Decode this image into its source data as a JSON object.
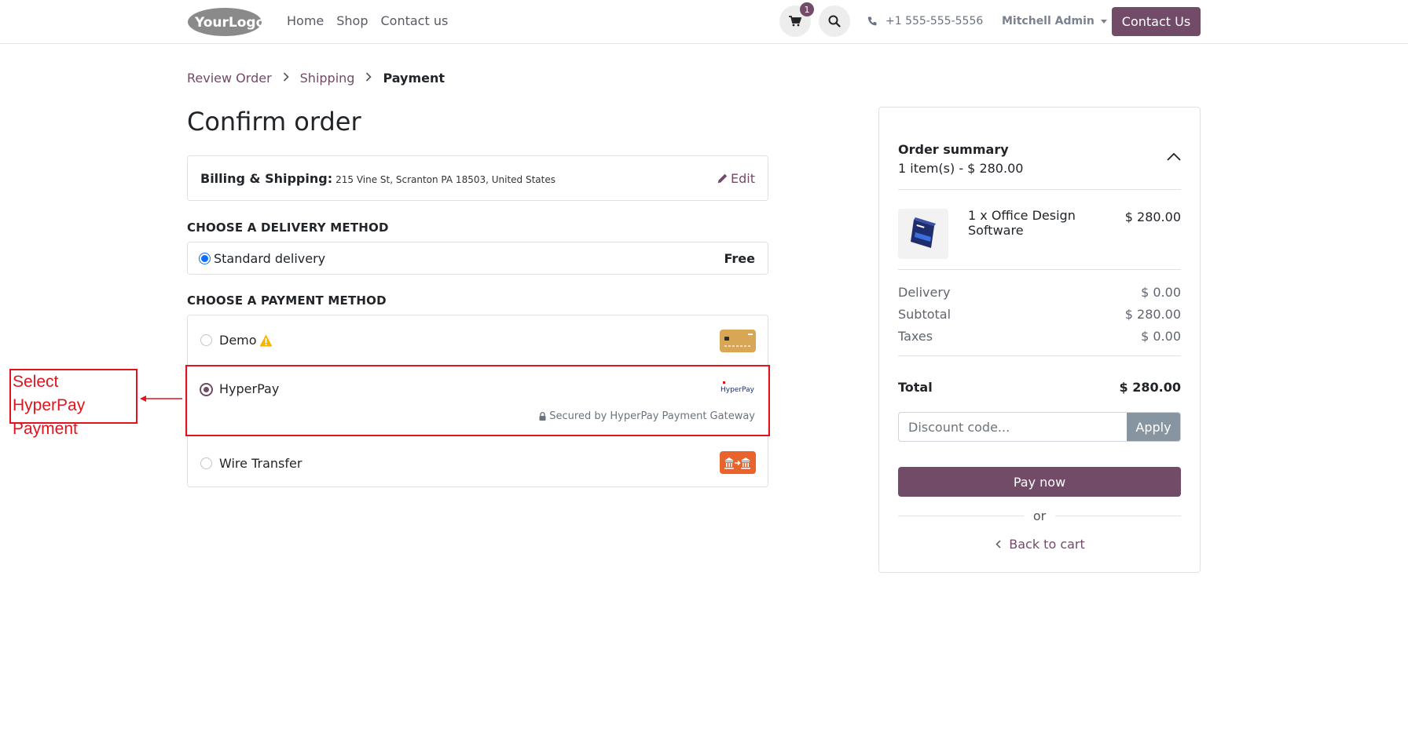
{
  "header": {
    "logo_text": "YourLogo",
    "nav": [
      "Home",
      "Shop",
      "Contact us"
    ],
    "cart_count": "1",
    "phone": "+1 555-555-5556",
    "user": "Mitchell Admin",
    "contact_button": "Contact Us"
  },
  "breadcrumb": {
    "items": [
      "Review Order",
      "Shipping",
      "Payment"
    ]
  },
  "page_title": "Confirm order",
  "billing": {
    "label": "Billing & Shipping:",
    "address": "215 Vine St, Scranton PA 18503, United States",
    "edit_label": "Edit"
  },
  "delivery": {
    "section_title": "CHOOSE A DELIVERY METHOD",
    "option_label": "Standard delivery",
    "option_price": "Free"
  },
  "payment": {
    "section_title": "CHOOSE A PAYMENT METHOD",
    "methods": [
      {
        "label": "Demo",
        "selected": false
      },
      {
        "label": "HyperPay",
        "selected": true
      },
      {
        "label": "Wire Transfer",
        "selected": false
      }
    ],
    "hyperpay_logo": "HyperPay",
    "secure_note": "Secured by HyperPay Payment Gateway"
  },
  "annotation": {
    "text_line1": "Select HyperPay",
    "text_line2": "Payment",
    "color": "#e0141e"
  },
  "summary": {
    "title": "Order summary",
    "subtitle": "1 item(s) -  $ 280.00",
    "product_name": "1 x Office Design Software",
    "product_price": "$ 280.00",
    "rows": [
      {
        "label": "Delivery",
        "value": "$ 0.00"
      },
      {
        "label": "Subtotal",
        "value": "$ 280.00"
      },
      {
        "label": "Taxes",
        "value": "$ 0.00"
      }
    ],
    "total_label": "Total",
    "total_value": "$ 280.00",
    "discount_placeholder": "Discount code...",
    "apply_label": "Apply",
    "pay_label": "Pay now",
    "or_label": "or",
    "back_label": "Back to cart"
  },
  "colors": {
    "brand": "#714b67",
    "annotation": "#e0141e"
  }
}
